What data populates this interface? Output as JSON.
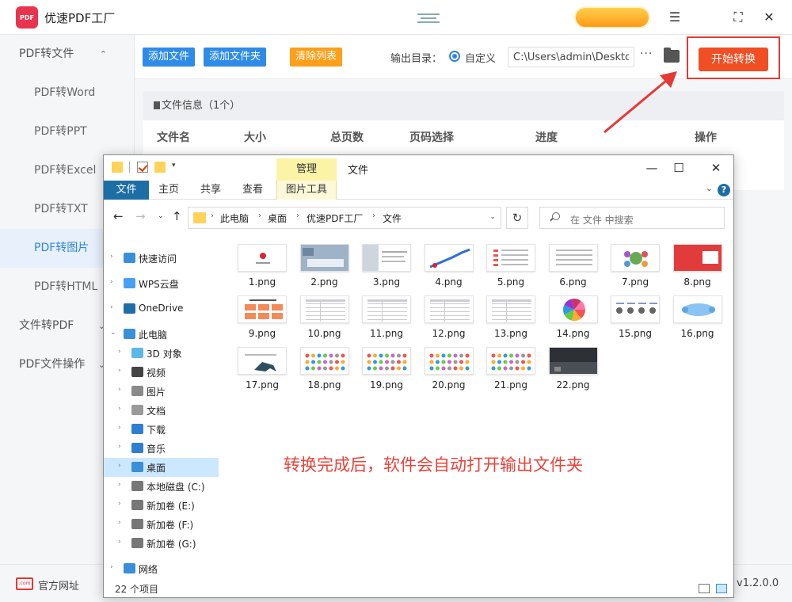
{
  "app": {
    "logo_text": "PDF",
    "title": "优速PDF工厂",
    "window_controls": [
      "☰",
      "⛶",
      "✕"
    ]
  },
  "sidebar": {
    "items": [
      {
        "label": "PDF转文件",
        "kind": "group",
        "chevron": "⌃"
      },
      {
        "label": "PDF转Word",
        "kind": "child"
      },
      {
        "label": "PDF转PPT",
        "kind": "child"
      },
      {
        "label": "PDF转Excel",
        "kind": "child"
      },
      {
        "label": "PDF转TXT",
        "kind": "child"
      },
      {
        "label": "PDF转图片",
        "kind": "child",
        "active": true
      },
      {
        "label": "PDF转HTML",
        "kind": "child"
      },
      {
        "label": "文件转PDF",
        "kind": "group",
        "chevron": "⌄"
      },
      {
        "label": "PDF文件操作",
        "kind": "group",
        "chevron": "⌄"
      }
    ]
  },
  "toolbar": {
    "add_file": "添加文件",
    "add_folder": "添加文件夹",
    "clear_list": "清除列表",
    "output_label": "输出目录：",
    "custom_label": "自定义",
    "output_path": "C:\\Users\\admin\\Desktop",
    "more_label": "···",
    "start_label": "开始转换"
  },
  "file_panel": {
    "header": "文件信息（1个）",
    "columns": [
      "文件名",
      "大小",
      "总页数",
      "页码选择",
      "进度",
      "操作"
    ]
  },
  "footer": {
    "web_icon_text": ".com",
    "web_label": "官方网址",
    "version": "v1.2.0.0"
  },
  "explorer": {
    "context_tab": "管理",
    "title": "文件",
    "ribbon_tabs": [
      "文件",
      "主页",
      "共享",
      "查看",
      "图片工具"
    ],
    "help": "?",
    "breadcrumb": [
      "此电脑",
      "桌面",
      "优速PDF工厂",
      "文件"
    ],
    "search_placeholder": "在 文件 中搜索",
    "nav_items": [
      {
        "label": "快速访问",
        "icon": "star-icon",
        "color": "#3a8fd9",
        "level": 0
      },
      {
        "label": "WPS云盘",
        "icon": "cloud-icon",
        "color": "#4a9ff5",
        "level": 0
      },
      {
        "label": "OneDrive",
        "icon": "cloud-icon",
        "color": "#1e6ea6",
        "level": 0
      },
      {
        "label": "此电脑",
        "icon": "computer-icon",
        "color": "#3a8fd9",
        "level": 0,
        "expanded": true
      },
      {
        "label": "3D 对象",
        "icon": "cube-icon",
        "color": "#5bb8e8",
        "level": 1
      },
      {
        "label": "视频",
        "icon": "video-icon",
        "color": "#444444",
        "level": 1
      },
      {
        "label": "图片",
        "icon": "picture-icon",
        "color": "#8a8a8a",
        "level": 1
      },
      {
        "label": "文档",
        "icon": "document-icon",
        "color": "#9a9a9a",
        "level": 1
      },
      {
        "label": "下载",
        "icon": "download-icon",
        "color": "#2f7fd1",
        "level": 1
      },
      {
        "label": "音乐",
        "icon": "music-icon",
        "color": "#2f7fd1",
        "level": 1
      },
      {
        "label": "桌面",
        "icon": "desktop-icon",
        "color": "#3a8fd9",
        "level": 1,
        "selected": true
      },
      {
        "label": "本地磁盘 (C:)",
        "icon": "drive-icon",
        "color": "#777777",
        "level": 1
      },
      {
        "label": "新加卷 (E:)",
        "icon": "drive-icon",
        "color": "#777777",
        "level": 1
      },
      {
        "label": "新加卷 (F:)",
        "icon": "drive-icon",
        "color": "#777777",
        "level": 1
      },
      {
        "label": "新加卷 (G:)",
        "icon": "drive-icon",
        "color": "#777777",
        "level": 1
      },
      {
        "label": "网络",
        "icon": "network-icon",
        "color": "#3a8fd9",
        "level": 0
      }
    ],
    "files": [
      "1.png",
      "2.png",
      "3.png",
      "4.png",
      "5.png",
      "6.png",
      "7.png",
      "8.png",
      "9.png",
      "10.png",
      "11.png",
      "12.png",
      "13.png",
      "14.png",
      "15.png",
      "16.png",
      "17.png",
      "18.png",
      "19.png",
      "20.png",
      "21.png",
      "22.png"
    ],
    "thumb_styles": [
      "logo",
      "photo",
      "doc",
      "chart",
      "list",
      "text",
      "diagram",
      "red",
      "orange",
      "table",
      "table",
      "table",
      "table",
      "pie",
      "steps",
      "bubbles",
      "dino",
      "dots",
      "dots",
      "dots",
      "dots",
      "dark"
    ],
    "note": "转换完成后，软件会自动打开输出文件夹",
    "status_count": "22 个项目"
  },
  "colors": {
    "accent": "#2e86de",
    "start": "#f04e23",
    "highlight": "#e53935",
    "clear": "#ff9f1a"
  }
}
